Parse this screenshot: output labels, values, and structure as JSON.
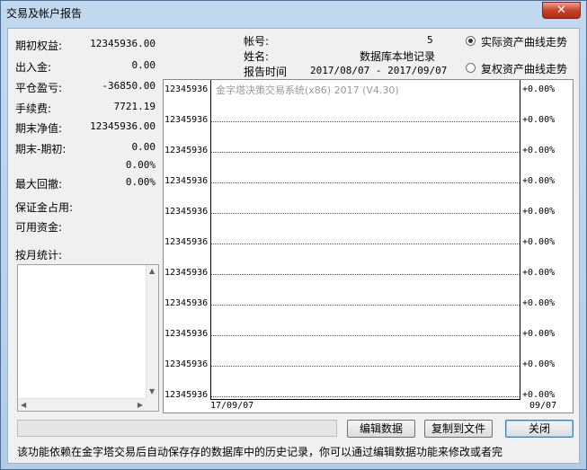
{
  "window": {
    "title": "交易及帐户报告",
    "close_glyph": "✕"
  },
  "stats": [
    {
      "label": "期初权益:",
      "value": "12345936.00"
    },
    {
      "label": "出入金:",
      "value": "0.00"
    },
    {
      "label": "平仓盈亏:",
      "value": "-36850.00"
    },
    {
      "label": "手续费:",
      "value": "7721.19"
    },
    {
      "label": "期末净值:",
      "value": "12345936.00"
    },
    {
      "label": "期末-期初:",
      "value": "0.00"
    },
    {
      "label": "",
      "value": "0.00%"
    },
    {
      "label": "最大回撤:",
      "value": "0.00%"
    },
    {
      "label": "保证金占用:",
      "value": ""
    },
    {
      "label": "可用资金:",
      "value": ""
    }
  ],
  "monthly_label": "按月统计:",
  "account": {
    "id_label": "帐号:",
    "id_value": "5",
    "name_label": "姓名:",
    "name_value": "数据库本地记录",
    "period_label": "报告时间",
    "period_value": "2017/08/07 - 2017/09/07"
  },
  "radios": [
    {
      "label": "实际资产曲线走势",
      "checked": true
    },
    {
      "label": "复权资产曲线走势",
      "checked": false
    }
  ],
  "chart_data": {
    "type": "line",
    "watermark": "金字塔决策交易系统(x86) 2017 (V4.30)",
    "y_ticks_left": [
      "12345936",
      "12345936",
      "12345936",
      "12345936",
      "12345936",
      "12345936",
      "12345936",
      "12345936",
      "12345936",
      "12345936",
      "12345936"
    ],
    "y_ticks_right": [
      "+0.00%",
      "+0.00%",
      "+0.00%",
      "+0.00%",
      "+0.00%",
      "+0.00%",
      "+0.00%",
      "+0.00%",
      "+0.00%",
      "+0.00%",
      "+0.00%"
    ],
    "x_ticks": [
      "17/09/07",
      "09/07"
    ],
    "series": [],
    "grid": true
  },
  "buttons": {
    "edit": "编辑数据",
    "copy": "复制到文件",
    "close": "关闭"
  },
  "status_text": "该功能依赖在金字塔交易后自动保存存的数据库中的历史记录，你可以通过编辑数据功能来修改或者完"
}
